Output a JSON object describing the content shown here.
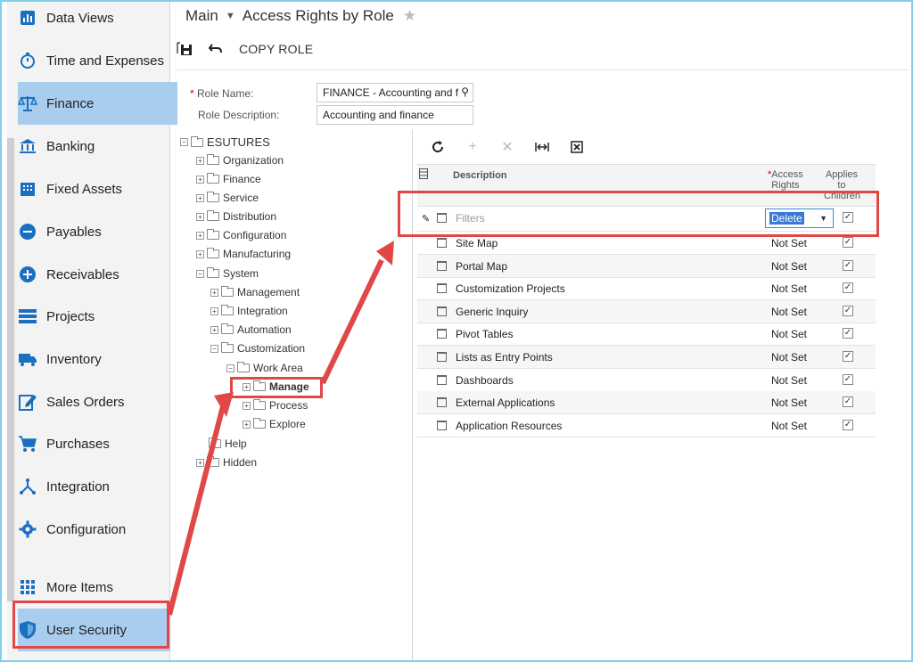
{
  "sidebar": {
    "items": [
      {
        "label": "Data Views",
        "icon": "bar-chart-icon"
      },
      {
        "label": "Time and Expenses",
        "icon": "stopwatch-icon"
      },
      {
        "label": "Finance",
        "icon": "scales-icon"
      },
      {
        "label": "Banking",
        "icon": "bank-icon"
      },
      {
        "label": "Fixed Assets",
        "icon": "building-icon"
      },
      {
        "label": "Payables",
        "icon": "minus-circle-icon"
      },
      {
        "label": "Receivables",
        "icon": "plus-circle-icon"
      },
      {
        "label": "Projects",
        "icon": "projects-list-icon"
      },
      {
        "label": "Inventory",
        "icon": "truck-icon"
      },
      {
        "label": "Sales Orders",
        "icon": "edit-note-icon"
      },
      {
        "label": "Purchases",
        "icon": "cart-icon"
      },
      {
        "label": "Integration",
        "icon": "network-icon"
      },
      {
        "label": "Configuration",
        "icon": "gear-icon"
      },
      {
        "label": "More Items",
        "icon": "grid-dots-icon"
      },
      {
        "label": "User Security",
        "icon": "shield-icon"
      }
    ],
    "active": "Finance"
  },
  "header": {
    "crumb_main": "Main",
    "title": "Access Rights by Role"
  },
  "toolbar": {
    "copy_role": "COPY ROLE"
  },
  "form": {
    "role_name_label": "Role Name:",
    "role_name_value": "FINANCE - Accounting and f",
    "role_desc_label": "Role Description:",
    "role_desc_value": "Accounting and finance"
  },
  "tree": {
    "root": "ESUTURES",
    "nodes": {
      "organization": "Organization",
      "finance": "Finance",
      "service": "Service",
      "distribution": "Distribution",
      "configuration": "Configuration",
      "manufacturing": "Manufacturing",
      "system": "System",
      "management": "Management",
      "integration": "Integration",
      "automation": "Automation",
      "customization": "Customization",
      "work_area": "Work Area",
      "manage": "Manage",
      "process": "Process",
      "explore": "Explore",
      "help": "Help",
      "hidden": "Hidden"
    }
  },
  "grid": {
    "columns": {
      "description": "Description",
      "access_rights_line1": "Access",
      "access_rights_line2": "Rights",
      "applies_line1": "Applies",
      "applies_line2": "to",
      "applies_line3": "Children"
    },
    "filter_row": {
      "description": "Filters",
      "access": "Delete",
      "applies": true
    },
    "rows": [
      {
        "description": "Site Map",
        "access": "Not Set",
        "applies": true
      },
      {
        "description": "Portal Map",
        "access": "Not Set",
        "applies": true
      },
      {
        "description": "Customization Projects",
        "access": "Not Set",
        "applies": true
      },
      {
        "description": "Generic Inquiry",
        "access": "Not Set",
        "applies": true
      },
      {
        "description": "Pivot Tables",
        "access": "Not Set",
        "applies": true
      },
      {
        "description": "Lists as Entry Points",
        "access": "Not Set",
        "applies": true
      },
      {
        "description": "Dashboards",
        "access": "Not Set",
        "applies": true
      },
      {
        "description": "External Applications",
        "access": "Not Set",
        "applies": true
      },
      {
        "description": "Application Resources",
        "access": "Not Set",
        "applies": true
      }
    ]
  },
  "colors": {
    "accent": "#1a6fc0",
    "active_bg": "#a9cdef",
    "annotation": "#e04848"
  }
}
